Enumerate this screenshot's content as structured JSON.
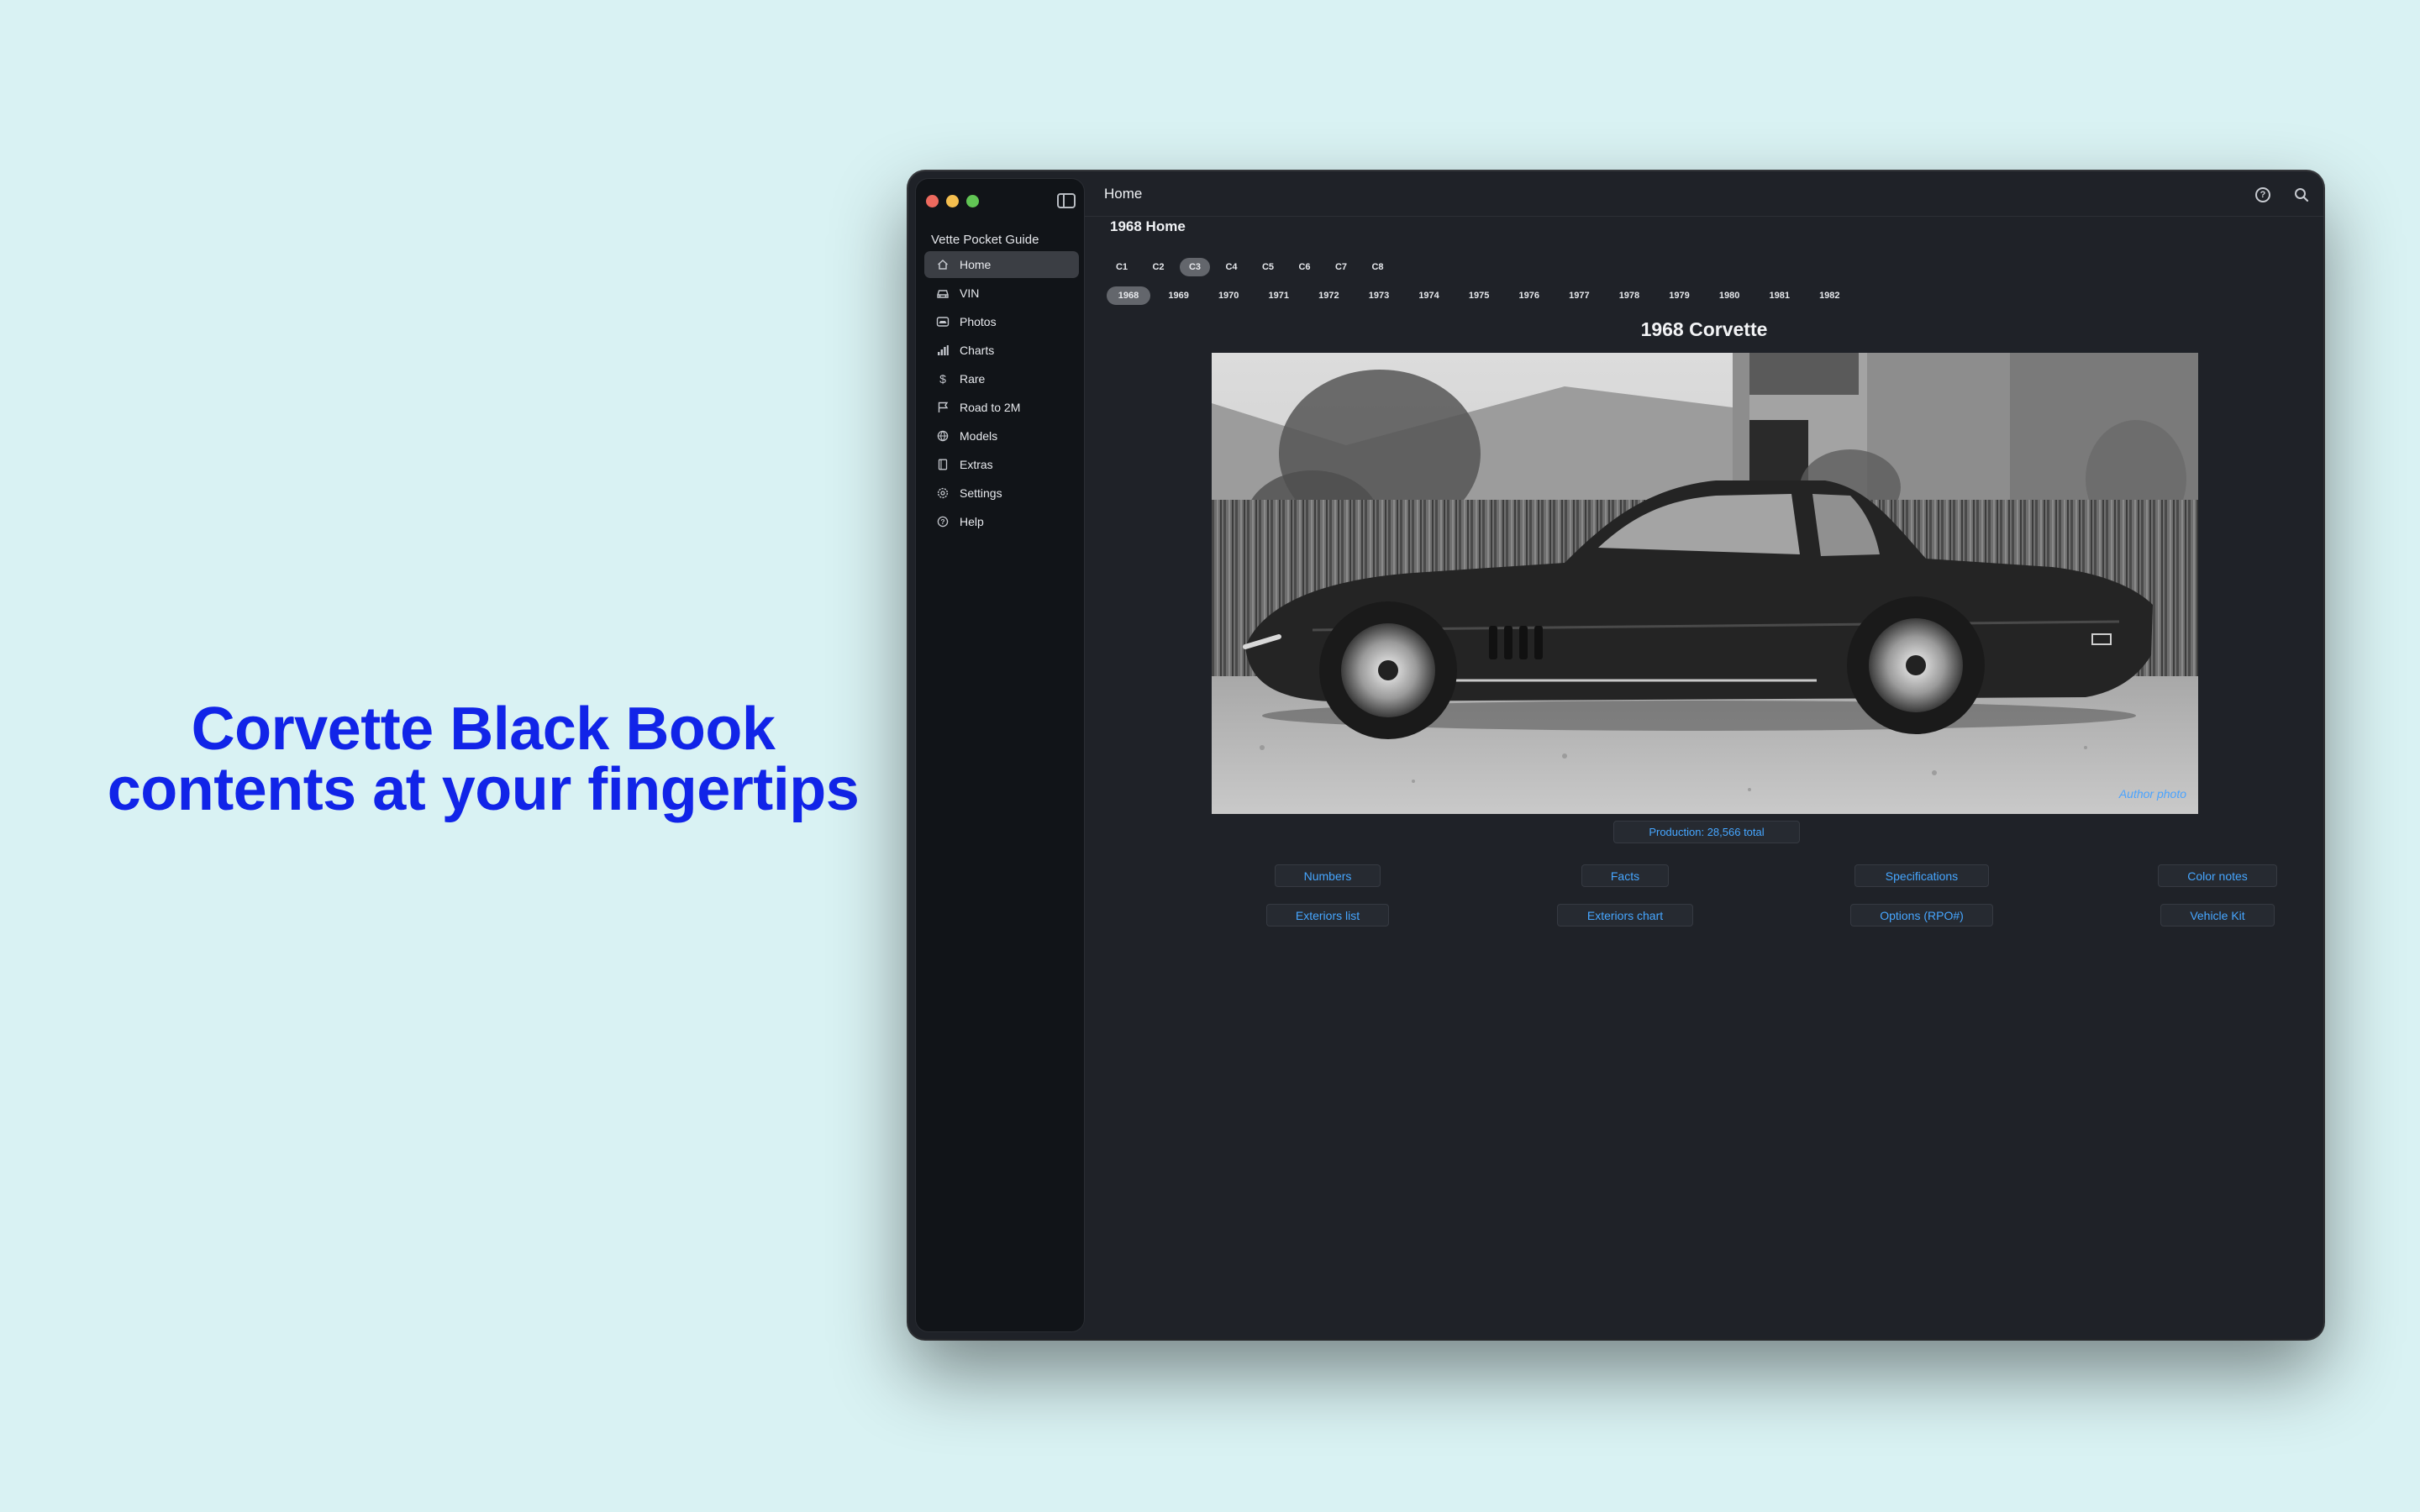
{
  "marketing": {
    "headline_line1": "Corvette Black Book",
    "headline_line2": "contents at your fingertips"
  },
  "window": {
    "app_name": "Vette Pocket Guide",
    "title": "Home"
  },
  "sidebar": {
    "items": [
      {
        "label": "Home",
        "icon": "house-icon",
        "active": true
      },
      {
        "label": "VIN",
        "icon": "car-icon"
      },
      {
        "label": "Photos",
        "icon": "car-photo-icon"
      },
      {
        "label": "Charts",
        "icon": "bar-chart-icon"
      },
      {
        "label": "Rare",
        "icon": "dollar-icon"
      },
      {
        "label": "Road to 2M",
        "icon": "flag-icon"
      },
      {
        "label": "Models",
        "icon": "globe-icon"
      },
      {
        "label": "Extras",
        "icon": "book-icon"
      },
      {
        "label": "Settings",
        "icon": "gear-icon"
      },
      {
        "label": "Help",
        "icon": "question-icon"
      }
    ]
  },
  "page": {
    "heading": "1968 Home",
    "generations": [
      "C1",
      "C2",
      "C3",
      "C4",
      "C5",
      "C6",
      "C7",
      "C8"
    ],
    "selected_generation": "C3",
    "years": [
      "1968",
      "1969",
      "1970",
      "1971",
      "1972",
      "1973",
      "1974",
      "1975",
      "1976",
      "1977",
      "1978",
      "1979",
      "1980",
      "1981",
      "1982"
    ],
    "selected_year": "1968",
    "car_title": "1968 Corvette",
    "photo_credit": "Author photo",
    "production": "Production: 28,566 total",
    "buttons": {
      "numbers": "Numbers",
      "facts": "Facts",
      "specifications": "Specifications",
      "color_notes": "Color notes",
      "exteriors_list": "Exteriors list",
      "exteriors_chart": "Exteriors chart",
      "options": "Options (RPO#)",
      "vehicle_kit": "Vehicle Kit"
    }
  },
  "colors": {
    "headline": "#1124e8",
    "background": "#d9f2f3",
    "link": "#46a6ff"
  }
}
